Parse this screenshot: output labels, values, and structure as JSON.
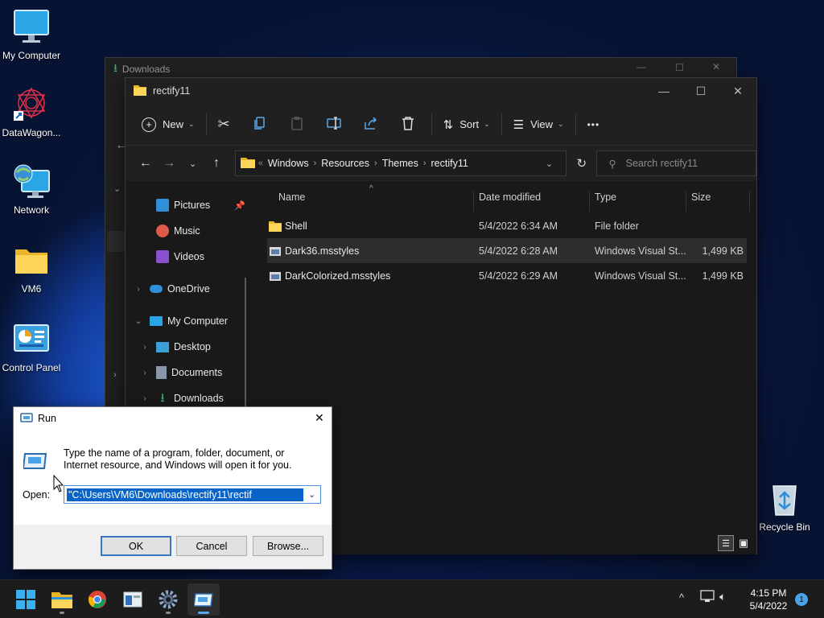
{
  "desktop": {
    "icons": [
      {
        "label": "My Computer",
        "icon": "monitor-icon"
      },
      {
        "label": "DataWagon...",
        "icon": "datawagon-icon"
      },
      {
        "label": "Network",
        "icon": "network-globe-icon"
      },
      {
        "label": "VM6",
        "icon": "folder-icon"
      },
      {
        "label": "Control Panel",
        "icon": "control-panel-icon"
      },
      {
        "label": "Recycle Bin",
        "icon": "recycle-bin-icon"
      }
    ]
  },
  "back_window": {
    "title": "Downloads"
  },
  "explorer": {
    "title": "rectify11",
    "toolbar": {
      "new_label": "New",
      "sort_label": "Sort",
      "view_label": "View",
      "more_label": "•••"
    },
    "address": {
      "root_glyph": "«",
      "crumbs": [
        "Windows",
        "Resources",
        "Themes",
        "rectify11"
      ]
    },
    "search_placeholder": "Search rectify11",
    "nav_items": {
      "pictures": "Pictures",
      "music": "Music",
      "videos": "Videos",
      "onedrive": "OneDrive",
      "my_computer": "My Computer",
      "desktop": "Desktop",
      "documents": "Documents",
      "downloads": "Downloads"
    },
    "columns": {
      "name": "Name",
      "date": "Date modified",
      "type": "Type",
      "size": "Size"
    },
    "files": [
      {
        "name": "Shell",
        "date": "5/4/2022 6:34 AM",
        "type": "File folder",
        "size": ""
      },
      {
        "name": "Dark36.msstyles",
        "date": "5/4/2022 6:28 AM",
        "type": "Windows Visual St...",
        "size": "1,499 KB"
      },
      {
        "name": "DarkColorized.msstyles",
        "date": "5/4/2022 6:29 AM",
        "type": "Windows Visual St...",
        "size": "1,499 KB"
      }
    ]
  },
  "run_dialog": {
    "title": "Run",
    "description": "Type the name of a program, folder, document, or Internet resource, and Windows will open it for you.",
    "open_label": "Open:",
    "open_value": "\"C:\\Users\\VM6\\Downloads\\rectify11\\rectif",
    "ok_label": "OK",
    "cancel_label": "Cancel",
    "browse_label": "Browse..."
  },
  "taskbar": {
    "time": "4:15 PM",
    "date": "5/4/2022",
    "notification_count": "1"
  },
  "colors": {
    "accent": "#0078d4",
    "selection": "#0a64c8"
  }
}
